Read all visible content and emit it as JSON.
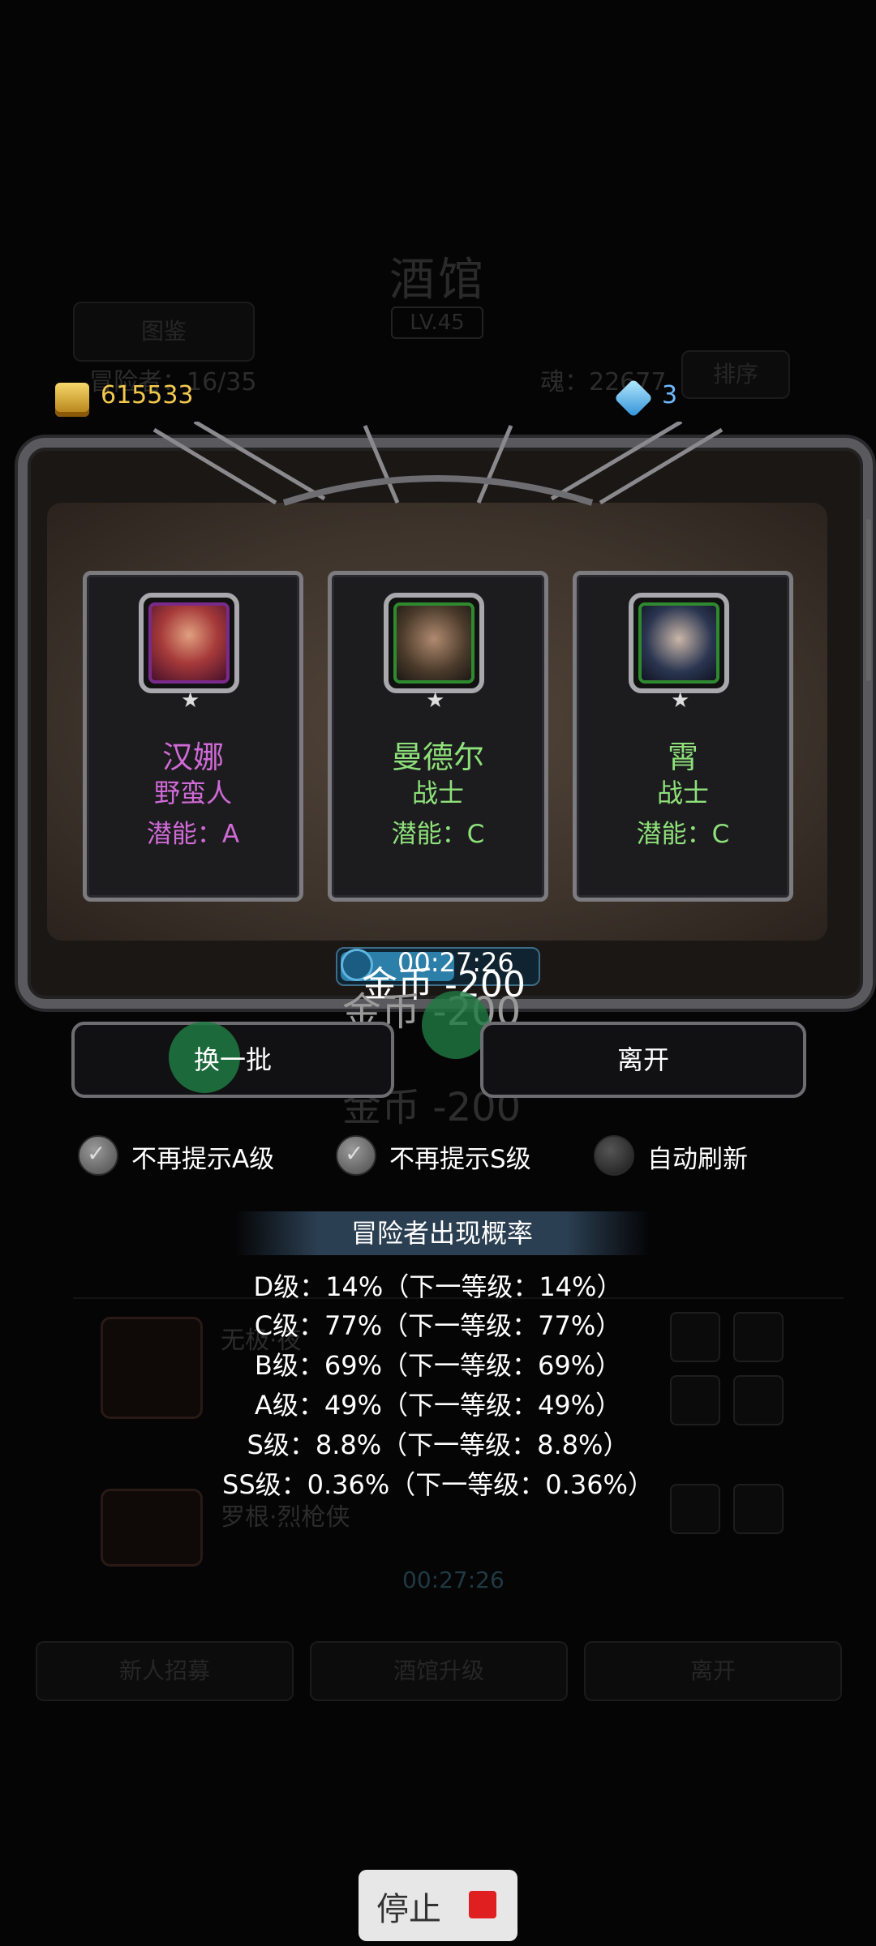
{
  "background": {
    "title": "酒馆",
    "level": "LV.45",
    "left_button": "图鉴",
    "adventurers": "冒险者：16/35",
    "souls": "魂：22677",
    "sort_button": "排序",
    "row1_name": "无极·夜",
    "row2_name": "罗根·烈枪侠",
    "timer": "00:27:26",
    "buttons": [
      "新人招募",
      "酒馆升级",
      "离开"
    ]
  },
  "resources": {
    "gold": "615533",
    "gems": "3"
  },
  "recruits": [
    {
      "name": "汉娜",
      "class": "野蛮人",
      "potential": "潜能：A",
      "color": "#cf6ad6",
      "frame": "#7a2a8a",
      "portrait_color": "#a63a3a"
    },
    {
      "name": "曼德尔",
      "class": "战士",
      "potential": "潜能：C",
      "color": "#8ee07a",
      "frame": "#2f8a2f",
      "portrait_color": "#4a3a2a"
    },
    {
      "name": "霄",
      "class": "战士",
      "potential": "潜能：C",
      "color": "#8ee07a",
      "frame": "#2f8a2f",
      "portrait_color": "#2a3550"
    }
  ],
  "timer": "00:27:26",
  "gold_floats": [
    "金币 -200",
    "金币 -200",
    "金币 -200"
  ],
  "actions": {
    "refresh": "换一批",
    "leave": "离开"
  },
  "options": [
    {
      "label": "不再提示A级",
      "checked": true
    },
    {
      "label": "不再提示S级",
      "checked": true
    },
    {
      "label": "自动刷新",
      "checked": false
    }
  ],
  "probability": {
    "title": "冒险者出现概率",
    "lines": [
      "D级：14%（下一等级：14%）",
      "C级：77%（下一等级：77%）",
      "B级：69%（下一等级：69%）",
      "A级：49%（下一等级：49%）",
      "S级：8.8%（下一等级：8.8%）",
      "SS级：0.36%（下一等级：0.36%）"
    ]
  },
  "stop_button": "停止"
}
